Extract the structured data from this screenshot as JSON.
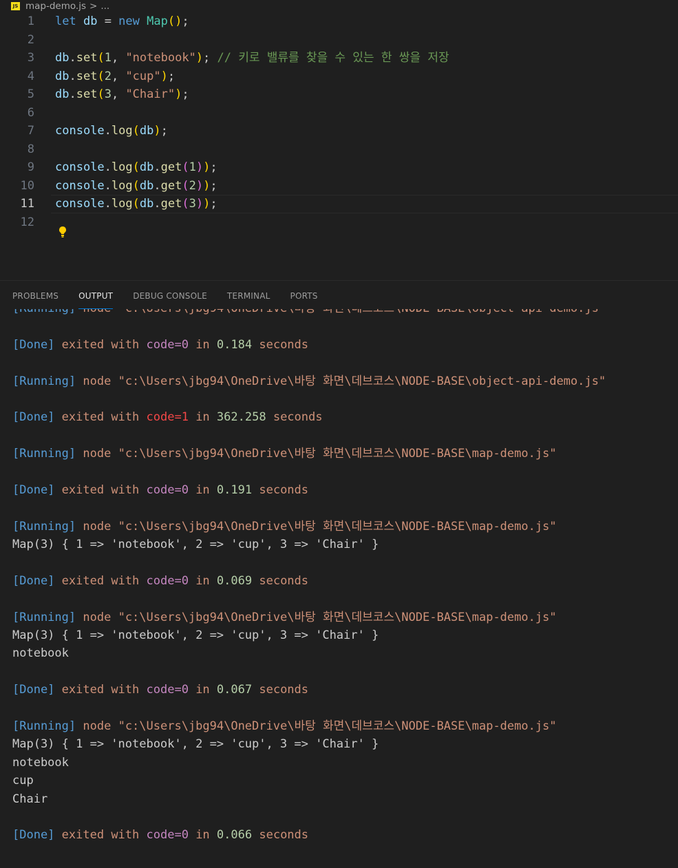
{
  "breadcrumb": {
    "file": "map-demo.js",
    "sep": ">",
    "more": "...",
    "icon": "js-file-icon"
  },
  "editor": {
    "line_numbers": [
      "1",
      "2",
      "3",
      "4",
      "5",
      "6",
      "7",
      "8",
      "9",
      "10",
      "11",
      "12"
    ],
    "active_line": 11,
    "comment": "// 키로 밸류를 찾을 수 있는 한 쌍을 저장",
    "keyword_let": "let",
    "keyword_new": "new",
    "var_db": "db",
    "class_map": "Map",
    "fn_set": "set",
    "fn_log": "log",
    "fn_get": "get",
    "obj_console": "console",
    "str_notebook": "\"notebook\"",
    "str_cup": "\"cup\"",
    "str_chair": "\"Chair\"",
    "num1": "1",
    "num2": "2",
    "num3": "3"
  },
  "panel": {
    "tabs": [
      "PROBLEMS",
      "OUTPUT",
      "DEBUG CONSOLE",
      "TERMINAL",
      "PORTS"
    ],
    "active_tab": "OUTPUT"
  },
  "output": {
    "clipped_line": "[Running] node \"c:\\Users\\jbg94\\OneDrive\\바탕 화면\\데브코스\\NODE-BASE\\object-api-demo.js\"",
    "running_tag": "[Running]",
    "done_tag": "[Done]",
    "node": "node",
    "path_object": "\"c:\\Users\\jbg94\\OneDrive\\바탕 화면\\데브코스\\NODE-BASE\\object-api-demo.js\"",
    "path_map": "\"c:\\Users\\jbg94\\OneDrive\\바탕 화면\\데브코스\\NODE-BASE\\map-demo.js\"",
    "exited_with": "exited with",
    "in": "in",
    "seconds": "seconds",
    "code0": "code=0",
    "code1": "code=1",
    "times": [
      "0.184",
      "362.258",
      "0.191",
      "0.069",
      "0.067",
      "0.066"
    ],
    "map_line": "Map(3) { 1 => 'notebook', 2 => 'cup', 3 => 'Chair' }",
    "notebook": "notebook",
    "cup": "cup",
    "chair": "Chair"
  }
}
